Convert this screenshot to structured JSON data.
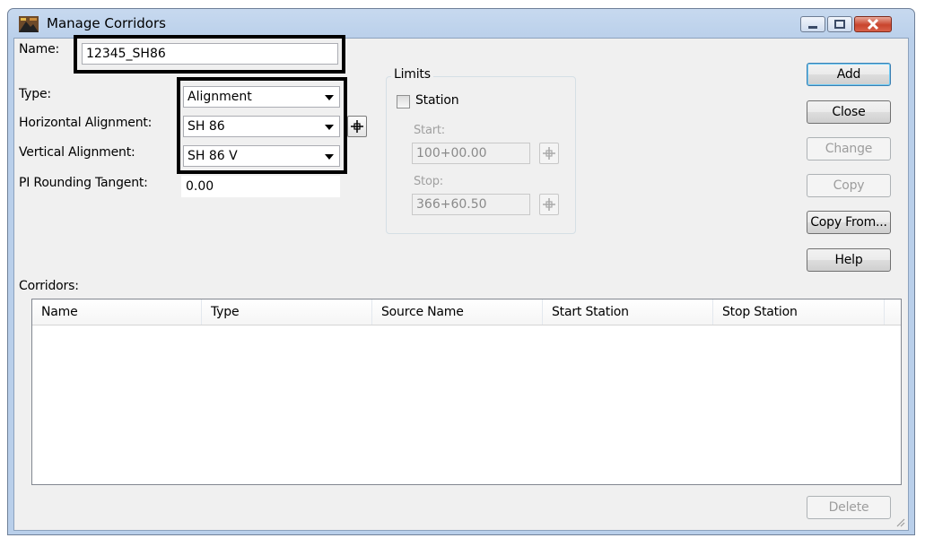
{
  "window": {
    "title": "Manage Corridors"
  },
  "form": {
    "name_label": "Name:",
    "name_value": "12345_SH86",
    "type_label": "Type:",
    "type_value": "Alignment",
    "horizontal_label": "Horizontal Alignment:",
    "horizontal_value": "SH 86",
    "vertical_label": "Vertical Alignment:",
    "vertical_value": "SH 86 V",
    "pi_label": "PI Rounding Tangent:",
    "pi_value": "0.00"
  },
  "limits": {
    "title": "Limits",
    "station_label": "Station",
    "station_checked": false,
    "start_label": "Start:",
    "start_value": "100+00.00",
    "stop_label": "Stop:",
    "stop_value": "366+60.50"
  },
  "buttons": {
    "add": "Add",
    "close": "Close",
    "change": "Change",
    "copy": "Copy",
    "copy_from": "Copy From...",
    "help": "Help",
    "delete": "Delete"
  },
  "corridors": {
    "label": "Corridors:",
    "columns": [
      "Name",
      "Type",
      "Source Name",
      "Start Station",
      "Stop Station"
    ],
    "rows": []
  },
  "colors": {
    "highlight_border": "#000000",
    "title_bar": "#b9cfea",
    "dialog_bg": "#f0f0f0"
  },
  "icons": [
    "app-icon",
    "minimize-icon",
    "maximize-icon",
    "close-icon",
    "crosshair-pick-icon",
    "resize-grip-icon"
  ]
}
